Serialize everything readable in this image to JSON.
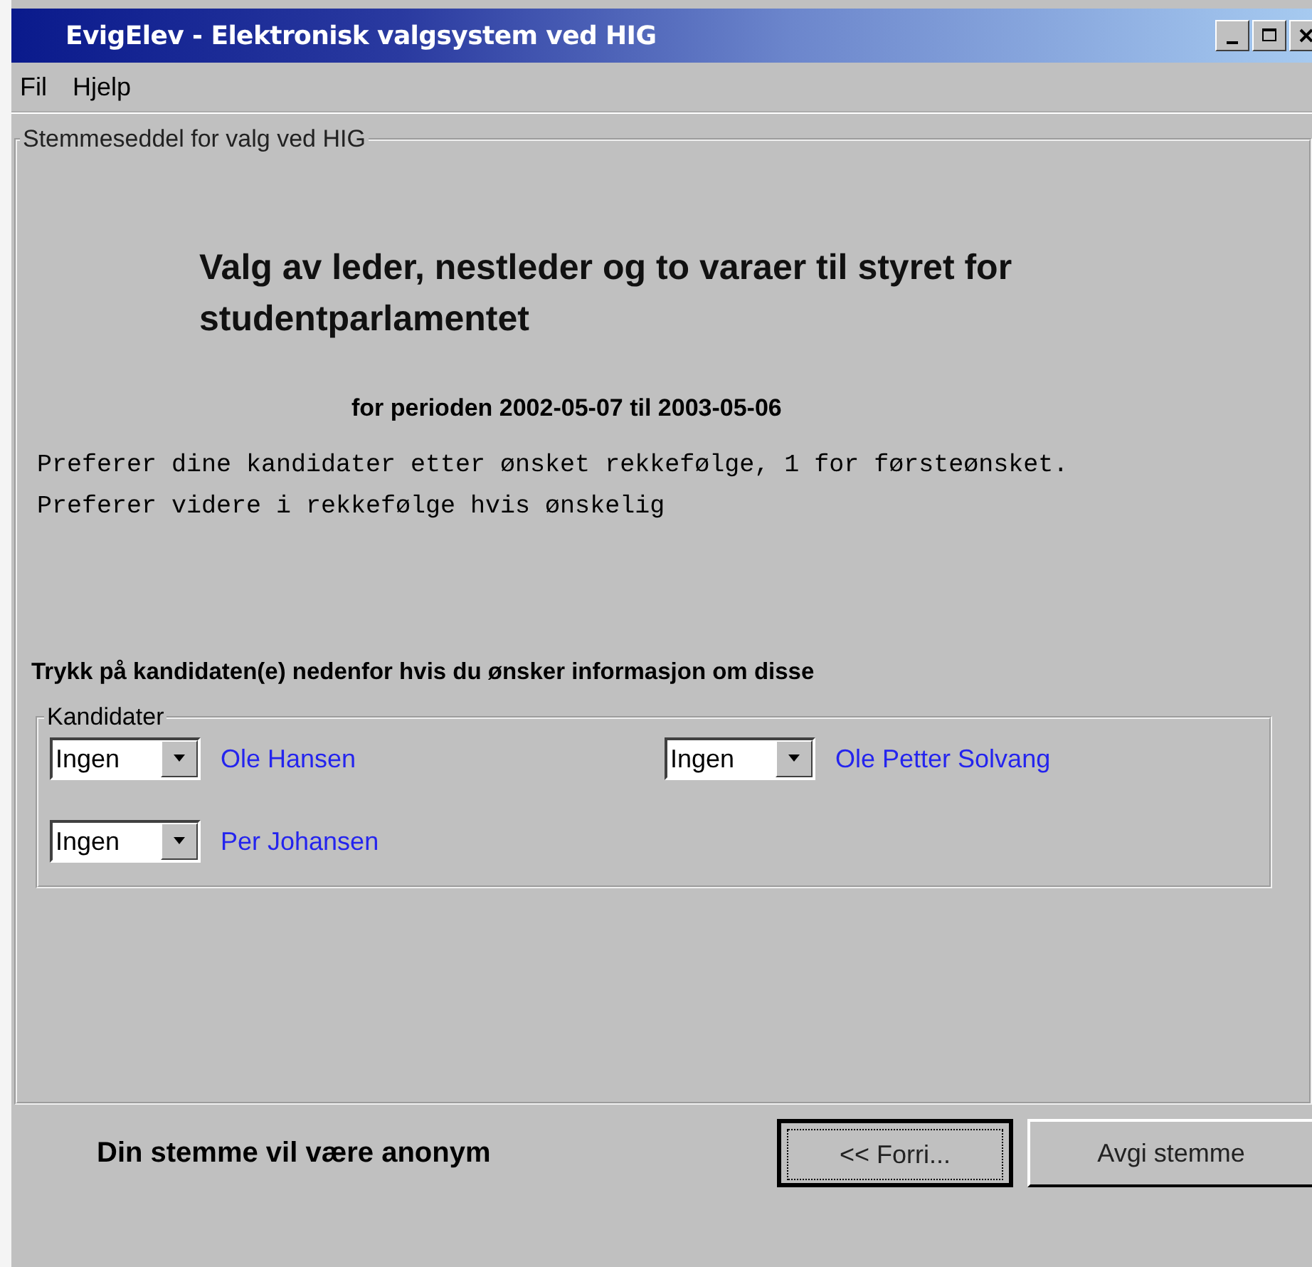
{
  "window": {
    "title": "EvigElev - Elektronisk valgsystem ved HIG"
  },
  "menu": [
    "Fil",
    "Hjelp"
  ],
  "ballot": {
    "legend": "Stemmeseddel for valg ved HIG",
    "heading": "Valg av leder, nestleder og to varaer til styret for studentparlamentet",
    "period": "for perioden 2002-05-07 til 2003-05-06",
    "instructions": "Preferer dine kandidater etter ønsket rekkefølge, 1 for førsteønsket. Preferer videre i rekkefølge hvis ønskelig",
    "info_prompt": "Trykk på kandidaten(e) nedenfor hvis du ønsker informasjon om disse",
    "candidates_legend": "Kandidater",
    "candidates": [
      {
        "rank": "Ingen",
        "name": "Ole Hansen"
      },
      {
        "rank": "Ingen",
        "name": "Ole Petter Solvang"
      },
      {
        "rank": "Ingen",
        "name": "Per Johansen"
      }
    ]
  },
  "footer": {
    "note": "Din stemme vil være anonym",
    "buttons": [
      {
        "label": "<< Forri...",
        "focused": true
      },
      {
        "label": "Avgi stemme",
        "focused": false
      }
    ]
  }
}
